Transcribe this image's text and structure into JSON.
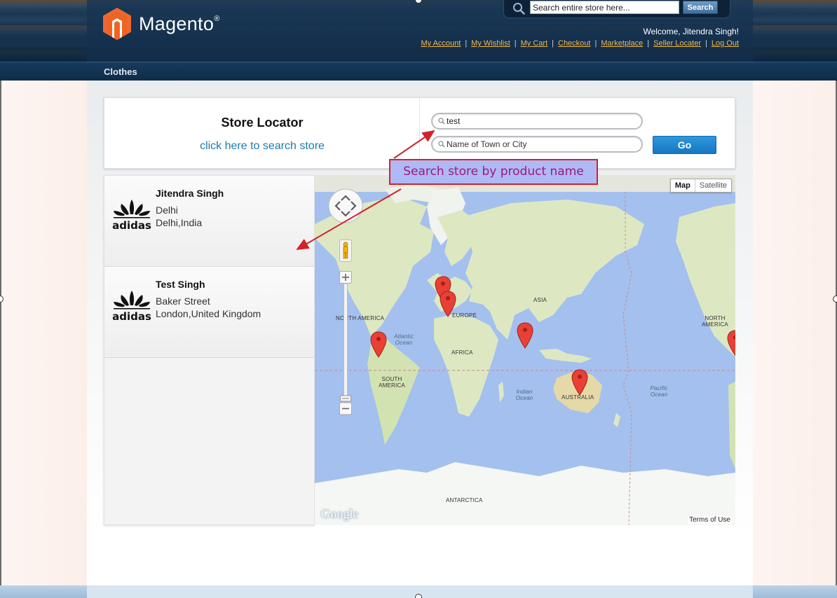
{
  "header": {
    "logo_text": "Magento",
    "logo_reg": "®",
    "search_placeholder": "Search entire store here...",
    "search_button": "Search",
    "welcome": "Welcome, Jitendra Singh!",
    "links": [
      "My Account",
      "My Wishlist",
      "My Cart",
      "Checkout",
      "Marketplace",
      "Seller Locater",
      "Log Out"
    ]
  },
  "nav": {
    "item": "Clothes"
  },
  "locator": {
    "title": "Store Locator",
    "link": "click here to search store",
    "product_value": "test",
    "city_placeholder": "Name of Town or City",
    "go": "Go"
  },
  "stores": [
    {
      "name": "Jitendra Singh",
      "line1": "Delhi",
      "line2": "Delhi,India",
      "logo": "adidas"
    },
    {
      "name": "Test Singh",
      "line1": "Baker Street",
      "line2": "London,United Kingdom",
      "logo": "adidas"
    }
  ],
  "map": {
    "type_map": "Map",
    "type_satellite": "Satellite",
    "google": "Google",
    "terms": "Terms of Use",
    "labels": {
      "north_america": "NORTH AMERICA",
      "north_america_right": "NORTH AMERICA",
      "south_america": "SOUTH AMERICA",
      "europe": "EUROPE",
      "asia": "ASIA",
      "africa": "AFRICA",
      "australia": "AUSTRALIA",
      "antarctica": "ANTARCTICA",
      "atlantic": "Atlantic Ocean",
      "indian": "Indian Ocean",
      "pacific": "Pacific Ocean"
    }
  },
  "annotation": {
    "text": "Search store by product name"
  },
  "colors": {
    "accent": "#1c7bb0",
    "go_button": "#1f86cf",
    "link": "#f2b84b",
    "annotation_border": "#d2232a",
    "annotation_fill": "#aeb9f5",
    "annotation_text": "#a6157a",
    "ocean": "#a4c0ee",
    "land": "#dde8c3"
  }
}
